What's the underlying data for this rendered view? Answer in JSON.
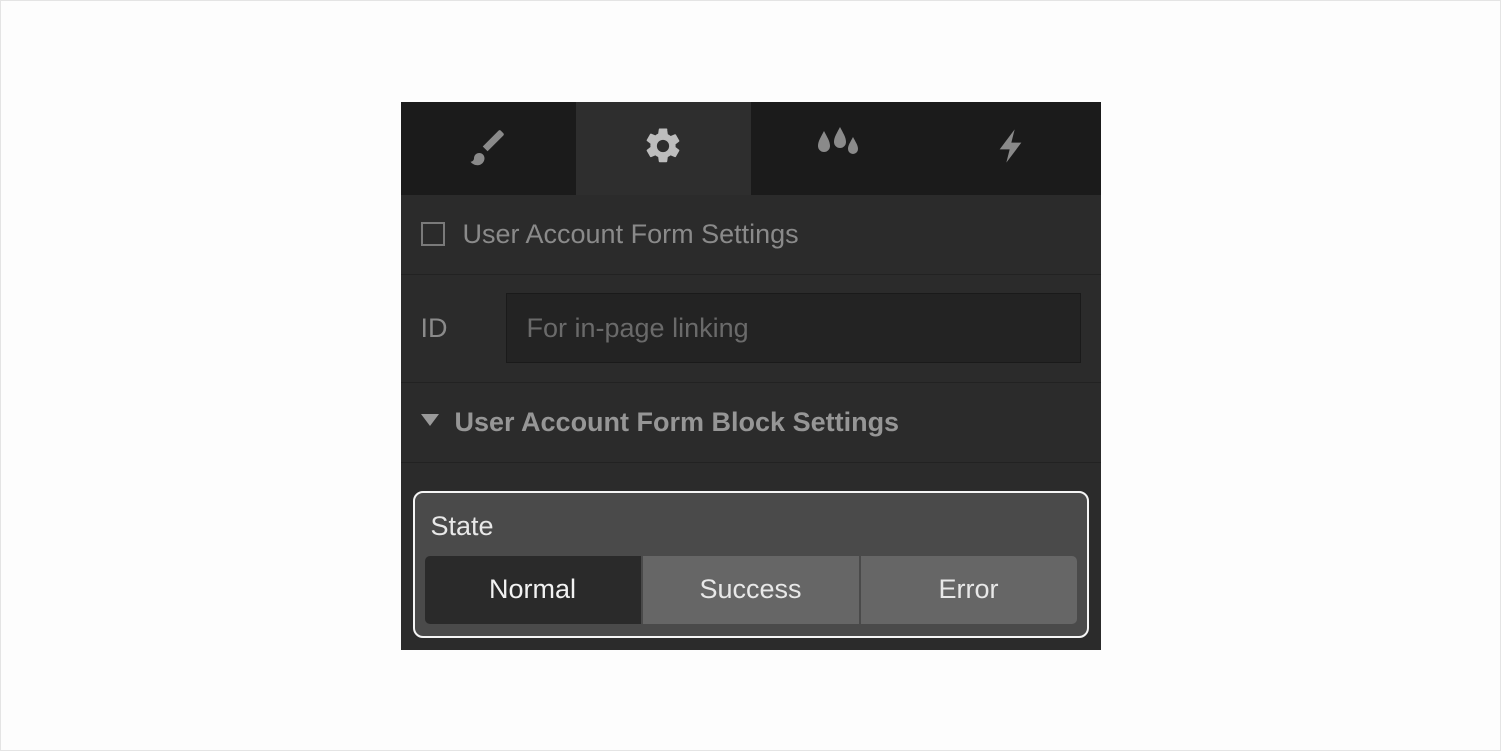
{
  "tabs": [
    {
      "name": "brush-icon"
    },
    {
      "name": "gear-icon"
    },
    {
      "name": "water-drops-icon"
    },
    {
      "name": "bolt-icon"
    }
  ],
  "active_tab_index": 1,
  "header": {
    "title": "User Account Form Settings"
  },
  "id_field": {
    "label": "ID",
    "placeholder": "For in-page linking",
    "value": ""
  },
  "block_settings": {
    "title": "User Account Form Block Settings"
  },
  "state": {
    "label": "State",
    "options": [
      "Normal",
      "Success",
      "Error"
    ],
    "active_index": 0
  }
}
